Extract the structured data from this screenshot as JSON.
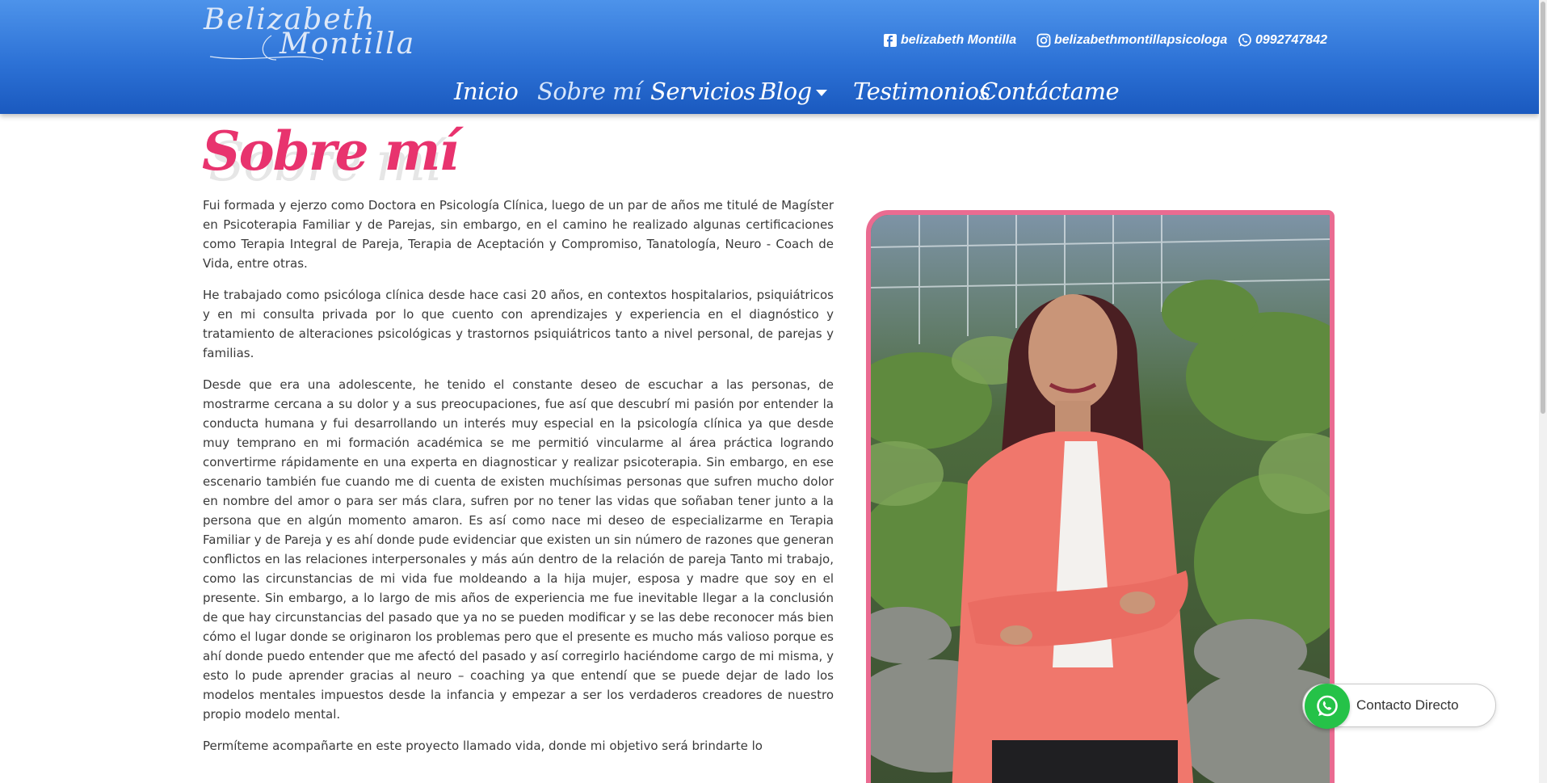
{
  "header": {
    "logo": {
      "line1": "Belizabeth",
      "line2": "Montilla"
    },
    "social": {
      "facebook": {
        "icon": "facebook-icon",
        "label": "belizabeth Montilla"
      },
      "instagram": {
        "icon": "instagram-icon",
        "label": "belizabethmontillapsicologa"
      },
      "whatsapp": {
        "icon": "whatsapp-icon",
        "label": "0992747842"
      }
    },
    "nav": [
      {
        "label": "Inicio",
        "active": false
      },
      {
        "label": "Sobre mí",
        "active": true
      },
      {
        "label": "Servicios",
        "active": false
      },
      {
        "label": "Blog",
        "active": false,
        "dropdown": true
      },
      {
        "label": "Testimonios",
        "active": false
      },
      {
        "label": "Contáctame",
        "active": false
      }
    ]
  },
  "main": {
    "title": "Sobre mí",
    "paragraphs": [
      "Fui formada y ejerzo como Doctora en Psicología Clínica, luego de un par de años me titulé de Magíster en Psicoterapia Familiar y de Parejas, sin embargo, en el camino he realizado algunas certificaciones como Terapia Integral de Pareja, Terapia de Aceptación y Compromiso, Tanatología, Neuro - Coach de Vida, entre otras.",
      "He trabajado como psicóloga clínica desde hace casi 20 años, en contextos hospitalarios, psiquiátricos y en mi consulta privada por lo que cuento con aprendizajes y experiencia en el diagnóstico y tratamiento de alteraciones psicológicas y trastornos psiquiátricos tanto a nivel personal, de parejas y familias.",
      "Desde que era una adolescente, he tenido el constante deseo de escuchar a las personas, de mostrarme cercana a su dolor y a sus preocupaciones, fue así que descubrí mi pasión por entender la conducta humana y fui desarrollando un interés muy especial en la psicología clínica ya que desde muy temprano en mi formación académica se me permitió vincularme al área práctica logrando convertirme rápidamente en una experta en diagnosticar y realizar psicoterapia. Sin embargo, en ese escenario también fue cuando me di cuenta de existen muchísimas personas que sufren mucho dolor en nombre del amor o para ser más clara, sufren por no tener las vidas que soñaban tener junto a la persona que en algún momento amaron. Es así como nace mi deseo de especializarme en Terapia Familiar y de Pareja y es ahí donde pude evidenciar que existen un sin número de razones que generan conflictos en las relaciones interpersonales y más aún dentro de la relación de pareja Tanto mi trabajo, como las circunstancias de mi vida fue moldeando a la hija mujer, esposa y madre que soy en el presente. Sin embargo, a lo largo de mis años de experiencia me fue inevitable llegar a la conclusión de que hay circunstancias del pasado que ya no se pueden modificar y se las debe reconocer más bien cómo el lugar donde se originaron los problemas pero que el presente es mucho más valioso porque es ahí donde puedo entender que me afectó del pasado y así corregirlo haciéndome cargo de mi misma, y esto lo pude aprender gracias al neuro – coaching ya que entendí que se puede dejar de lado los modelos mentales impuestos desde la infancia y empezar a ser los verdaderos creadores de nuestro propio modelo mental.",
      "Permíteme acompañarte en este proyecto llamado vida, donde mi objetivo será brindarte lo"
    ]
  },
  "contact_button": {
    "label": "Contacto Directo",
    "icon": "whatsapp-icon"
  },
  "colors": {
    "header_top": "#4d93ea",
    "header_bottom": "#1a59bf",
    "accent_pink": "#e8336e",
    "photo_border": "#ea6b91",
    "whatsapp_green": "#25c248"
  }
}
